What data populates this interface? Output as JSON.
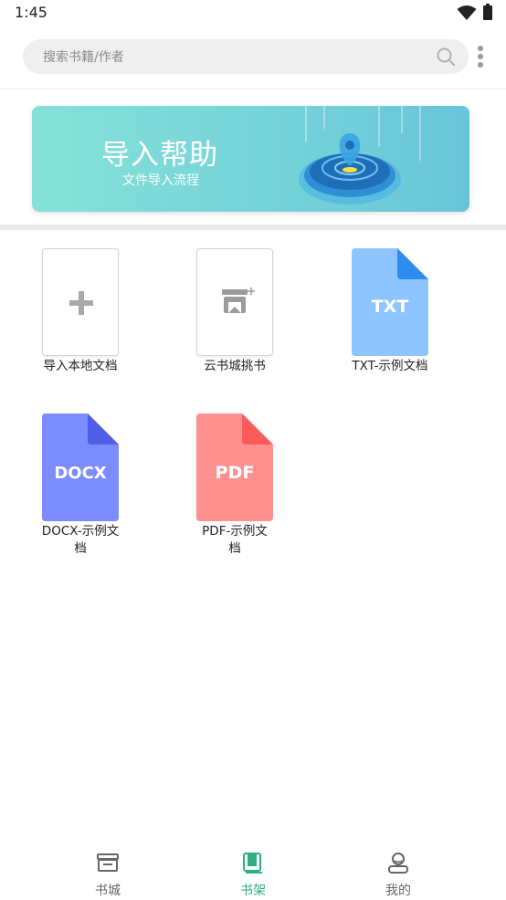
{
  "status_bar": {
    "time": "1:45"
  },
  "search": {
    "placeholder": "搜索书籍/作者"
  },
  "banner": {
    "title": "导入帮助",
    "subtitle": "文件导入流程"
  },
  "books": [
    {
      "label": "导入本地文档",
      "type": "import"
    },
    {
      "label": "云书城挑书",
      "type": "store"
    },
    {
      "label": "TXT-示例文档",
      "type": "file",
      "badge": "TXT",
      "color": "#8ec5ff",
      "fold_color": "#2d8cf0"
    },
    {
      "label": "DOCX-示例文\n档",
      "type": "file",
      "badge": "DOCX",
      "color": "#7c8cff",
      "fold_color": "#4f5ee8"
    },
    {
      "label": "PDF-示例文\n档",
      "type": "file",
      "badge": "PDF",
      "color": "#ff9090",
      "fold_color": "#ff5a5a"
    }
  ],
  "nav": {
    "items": [
      {
        "label": "书城",
        "icon": "store-icon",
        "active": false
      },
      {
        "label": "书架",
        "icon": "bookshelf-icon",
        "active": true
      },
      {
        "label": "我的",
        "icon": "profile-icon",
        "active": false
      }
    ],
    "active_color": "#2fae84"
  }
}
